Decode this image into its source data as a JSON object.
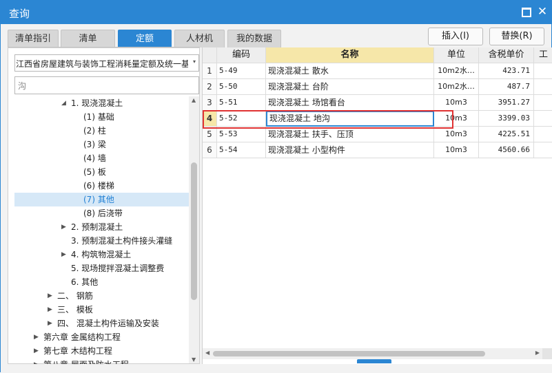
{
  "window": {
    "title": "查询",
    "maximize_icon": "maximize-icon",
    "close_icon": "close-icon",
    "close_glyph": "✕"
  },
  "tabs": [
    {
      "label": "清单指引",
      "active": false
    },
    {
      "label": "清单",
      "active": false
    },
    {
      "label": "定额",
      "active": true
    },
    {
      "label": "人材机",
      "active": false
    },
    {
      "label": "我的数据",
      "active": false
    }
  ],
  "actions": {
    "insert_label": "插入(I)",
    "replace_label": "替换(R)"
  },
  "left": {
    "quota_library": "江西省房屋建筑与装饰工程消耗量定额及统一基价表",
    "search_value": "沟",
    "tree": [
      {
        "label": "1. 现浇混凝土",
        "expanded": true,
        "toggle": "◢"
      },
      {
        "label": "(1) 基础"
      },
      {
        "label": "(2) 柱"
      },
      {
        "label": "(3) 梁"
      },
      {
        "label": "(4) 墙"
      },
      {
        "label": "(5) 板"
      },
      {
        "label": "(6) 楼梯"
      },
      {
        "label": "(7) 其他",
        "selected": true
      },
      {
        "label": "(8) 后浇带"
      },
      {
        "label": "2. 预制混凝土",
        "toggle": "▶"
      },
      {
        "label": "3. 预制混凝土构件接头灌缝"
      },
      {
        "label": "4. 构筑物混凝土",
        "toggle": "▶"
      },
      {
        "label": "5. 现场搅拌混凝土调整费"
      },
      {
        "label": "6. 其他"
      },
      {
        "label": "二、 钢筋",
        "toggle": "▶"
      },
      {
        "label": "三、 模板",
        "toggle": "▶"
      },
      {
        "label": "四、 混凝土构件运输及安装",
        "toggle": "▶"
      },
      {
        "label": "第六章 金属结构工程",
        "toggle": "▶"
      },
      {
        "label": "第七章 木结构工程",
        "toggle": "▶"
      },
      {
        "label": "第八章 屋面及防水工程",
        "toggle": "▶"
      }
    ]
  },
  "grid": {
    "headers": [
      "",
      "编码",
      "名称",
      "单位",
      "含税单价",
      "工"
    ],
    "rows": [
      [
        "1",
        "5-49",
        "现浇混凝土 散水",
        "10m2水…",
        "423.71"
      ],
      [
        "2",
        "5-50",
        "现浇混凝土 台阶",
        "10m2水…",
        "487.7"
      ],
      [
        "3",
        "5-51",
        "现浇混凝土 场馆看台",
        "10m3",
        "3951.27"
      ],
      [
        "4",
        "5-52",
        "现浇混凝土 地沟",
        "10m3",
        "3399.03"
      ],
      [
        "5",
        "5-53",
        "现浇混凝土 扶手、压顶",
        "10m3",
        "4225.51"
      ],
      [
        "6",
        "5-54",
        "现浇混凝土 小型构件",
        "10m3",
        "4560.66"
      ]
    ],
    "current_row": 4,
    "highlighted_row": 4
  },
  "icons": {
    "expand": "▶",
    "collapse": "◢",
    "dropdown": "▾",
    "up": "▲",
    "down": "▼",
    "left": "◀",
    "right": "▶"
  },
  "colors": {
    "accent": "#2b86d3",
    "highlight": "#e03232",
    "current_row": "#f6e7a9"
  }
}
